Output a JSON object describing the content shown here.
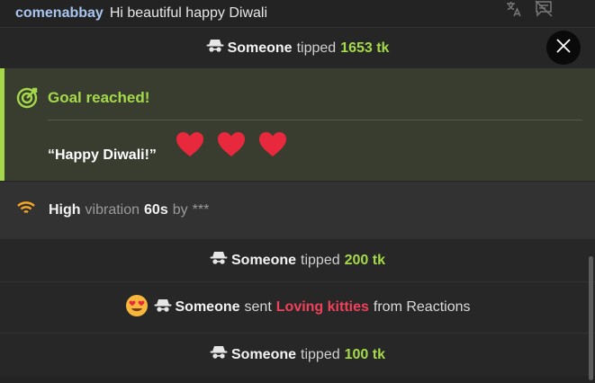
{
  "chat_message": {
    "username": "comenabbay",
    "text": "Hi beautiful happy Diwali"
  },
  "tip_events": [
    {
      "user": "Someone",
      "verb": "tipped",
      "amount": "1653 tk"
    },
    {
      "user": "Someone",
      "verb": "tipped",
      "amount": "200 tk"
    },
    {
      "user": "Someone",
      "verb": "tipped",
      "amount": "100 tk"
    }
  ],
  "goal": {
    "title": "Goal reached!",
    "message": "“Happy Diwali!”",
    "hearts": 3
  },
  "vibration": {
    "level": "High",
    "label": "vibration",
    "duration": "60s",
    "by": "by",
    "user": "***"
  },
  "reaction_event": {
    "user": "Someone",
    "verb": "sent",
    "item": "Loving kitties",
    "suffix": "from Reactions"
  },
  "colors": {
    "accent_green": "#a4d94a",
    "reaction_red": "#f0415a",
    "username_blue": "#a8c5f0",
    "vibration_orange": "#f5a623",
    "heart_red": "#e8283c"
  },
  "icons": [
    "translate-icon",
    "chat-off-icon",
    "close-icon",
    "anonymous-spy-icon",
    "target-icon",
    "vibration-wave-icon",
    "heart-eyes-emoji",
    "heart-emoji"
  ]
}
